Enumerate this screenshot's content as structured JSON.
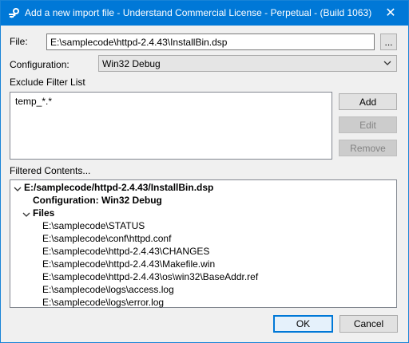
{
  "window": {
    "title": "Add a new import file - Understand Commercial License - Perpetual - (Build 1063)",
    "close_symbol": "✕"
  },
  "file": {
    "label": "File:",
    "value": "E:\\samplecode\\httpd-2.4.43\\InstallBin.dsp",
    "browse_label": "..."
  },
  "configuration": {
    "label": "Configuration:",
    "selected": "Win32 Debug"
  },
  "exclude": {
    "label": "Exclude Filter List",
    "items": [
      "temp_*.*"
    ],
    "add_label": "Add",
    "edit_label": "Edit",
    "remove_label": "Remove"
  },
  "filtered": {
    "label": "Filtered Contents...",
    "root": "E:/samplecode/httpd-2.4.43/InstallBin.dsp",
    "configuration": "Configuration: Win32 Debug",
    "files_label": "Files",
    "files": [
      "E:\\samplecode\\STATUS",
      "E:\\samplecode\\conf\\httpd.conf",
      "E:\\samplecode\\httpd-2.4.43\\CHANGES",
      "E:\\samplecode\\httpd-2.4.43\\Makefile.win",
      "E:\\samplecode\\httpd-2.4.43\\os\\win32\\BaseAddr.ref",
      "E:\\samplecode\\logs\\access.log",
      "E:\\samplecode\\logs\\error.log"
    ]
  },
  "footer": {
    "ok_label": "OK",
    "cancel_label": "Cancel"
  },
  "icons": {
    "app": "app-icon",
    "close": "close-icon",
    "combo": "chevron-down-icon",
    "tree": "chevron-down-icon"
  },
  "colors": {
    "titlebar": "#0078d7",
    "accent": "#0078d7"
  }
}
